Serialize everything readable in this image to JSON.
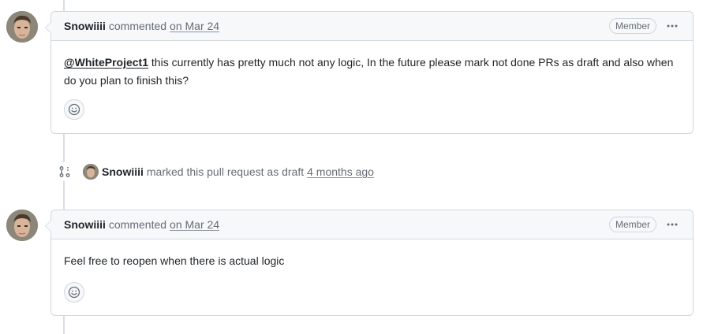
{
  "comments": [
    {
      "author": "Snowiiii",
      "action": "commented",
      "date": "on Mar 24",
      "badge": "Member",
      "mention": "@WhiteProject1",
      "body": " this currently has pretty much not any logic, In the future please mark not done PRs as draft and also when do you plan to finish this?"
    },
    {
      "author": "Snowiiii",
      "action": "commented",
      "date": "on Mar 24",
      "badge": "Member",
      "mention": "",
      "body": "Feel free to reopen when there is actual logic"
    }
  ],
  "event": {
    "author": "Snowiiii",
    "text": "marked this pull request as draft",
    "time": "4 months ago"
  },
  "icons": {
    "more": "kebab-horizontal-icon",
    "reaction": "smiley-icon",
    "event": "git-pull-request-draft-icon"
  },
  "colors": {
    "border": "#d0d7de",
    "header_bg": "#f6f8fa",
    "muted_text": "#656d76"
  }
}
